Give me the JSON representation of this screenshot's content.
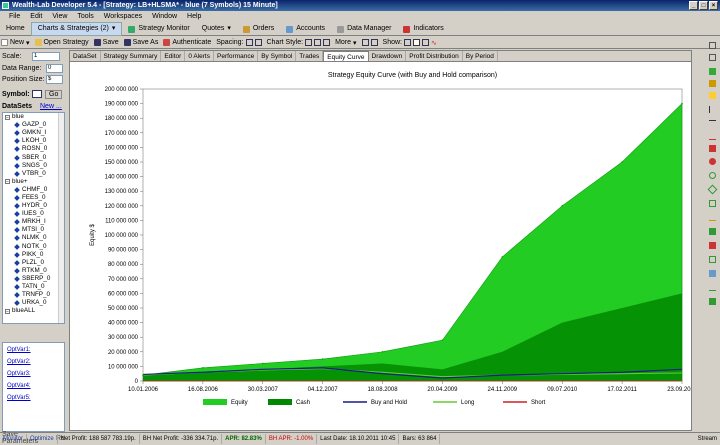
{
  "window": {
    "title": "Wealth-Lab Developer 5.4 - [Strategy: LB+HLSMA* - blue (7 Symbols) 15 Minute]"
  },
  "menu": [
    "File",
    "Edit",
    "View",
    "Tools",
    "Workspaces",
    "Window",
    "Help"
  ],
  "main_tabs": [
    "Home",
    "Charts & Strategies (2)",
    "Strategy Monitor",
    "Quotes",
    "Orders",
    "Accounts",
    "Data Manager",
    "Indicators"
  ],
  "toolbar": {
    "new": "New",
    "open": "Open Strategy",
    "save": "Save",
    "save_as": "Save As",
    "authenticate": "Authenticate",
    "spacing": "Spacing:",
    "chart_style": "Chart Style:",
    "more": "More",
    "show": "Show:"
  },
  "left": {
    "scale_label": "Scale:",
    "scale_value": "1",
    "data_range_label": "Data Range:",
    "data_range_value": "0",
    "position_size_label": "Position Size:",
    "position_size_value": "$",
    "symbol_label": "Symbol:",
    "go": "Go",
    "datasets_label": "DataSets",
    "new_link": "New ..."
  },
  "tree": [
    {
      "type": "group",
      "label": "blue"
    },
    {
      "type": "item",
      "label": "GAZP_0"
    },
    {
      "type": "item",
      "label": "GMKN_I"
    },
    {
      "type": "item",
      "label": "LKOH_0"
    },
    {
      "type": "item",
      "label": "ROSN_0"
    },
    {
      "type": "item",
      "label": "SBER_0"
    },
    {
      "type": "item",
      "label": "SNGS_0"
    },
    {
      "type": "item",
      "label": "VTBR_0"
    },
    {
      "type": "group",
      "label": "blue+"
    },
    {
      "type": "item",
      "label": "CHMF_0"
    },
    {
      "type": "item",
      "label": "FEES_0"
    },
    {
      "type": "item",
      "label": "HYDR_0"
    },
    {
      "type": "item",
      "label": "IUES_0"
    },
    {
      "type": "item",
      "label": "MRKH_I"
    },
    {
      "type": "item",
      "label": "MTSI_0"
    },
    {
      "type": "item",
      "label": "NLMK_0"
    },
    {
      "type": "item",
      "label": "NOTK_0"
    },
    {
      "type": "item",
      "label": "PIKK_0"
    },
    {
      "type": "item",
      "label": "PLZL_0"
    },
    {
      "type": "item",
      "label": "RTKM_0"
    },
    {
      "type": "item",
      "label": "SBERP_0"
    },
    {
      "type": "item",
      "label": "TATN_0"
    },
    {
      "type": "item",
      "label": "TRNFP_0"
    },
    {
      "type": "item",
      "label": "URKA_0"
    },
    {
      "type": "group",
      "label": "blueALL"
    }
  ],
  "opt_vars": [
    "OptVar1:",
    "OptVar2:",
    "OptVar3:",
    "OptVar4:",
    "OptVar5:"
  ],
  "save_parameters": "Save Parameters",
  "save_parameters_short": "Re",
  "sub_tabs": [
    "DataSet",
    "Strategy Summary",
    "Editor",
    "0 Alerts",
    "Performance",
    "By Symbol",
    "Trades",
    "Equity Curve",
    "Drawdown",
    "Profit Distribution",
    "By Period"
  ],
  "active_sub_tab": "Equity Curve",
  "chart_data": {
    "type": "area",
    "title": "Strategy Equity Curve (with Buy and Hold comparison)",
    "ylabel": "Equity $",
    "xlabel": "",
    "ylim": [
      0,
      200000000
    ],
    "yticks": [
      "0",
      "10 000 000",
      "20 000 000",
      "30 000 000",
      "40 000 000",
      "50 000 000",
      "60 000 000",
      "70 000 000",
      "80 000 000",
      "90 000 000",
      "100 000 000",
      "110 000 000",
      "120 000 000",
      "130 000 000",
      "140 000 000",
      "150 000 000",
      "160 000 000",
      "170 000 000",
      "180 000 000",
      "190 000 000",
      "200 000 000"
    ],
    "xticks": [
      "10.01.2006",
      "16.08.2006",
      "30.03.2007",
      "04.12.2007",
      "18.08.2008",
      "20.04.2009",
      "24.11.2009",
      "09.07.2010",
      "17.02.2011",
      "23.09.2011"
    ],
    "x": [
      "10.01.2006",
      "16.08.2006",
      "30.03.2007",
      "04.12.2007",
      "18.08.2008",
      "20.04.2009",
      "24.11.2009",
      "09.07.2010",
      "17.02.2011",
      "23.09.2011"
    ],
    "series": [
      {
        "name": "Equity",
        "color": "#22cc22",
        "values": [
          4000000,
          9000000,
          12000000,
          15000000,
          20000000,
          28000000,
          85000000,
          120000000,
          150000000,
          190000000
        ]
      },
      {
        "name": "Cash",
        "color": "#008800",
        "values": [
          4000000,
          6000000,
          8000000,
          10000000,
          12000000,
          8000000,
          20000000,
          40000000,
          50000000,
          60000000
        ]
      },
      {
        "name": "Buy and Hold",
        "color": "#1a1a8a",
        "values": [
          4500000,
          6000000,
          8000000,
          9000000,
          5000000,
          2000000,
          4000000,
          5000000,
          6000000,
          8000000
        ]
      },
      {
        "name": "Long",
        "color": "#66cc33",
        "values": [
          4000000,
          6000000,
          7500000,
          8500000,
          6000000,
          3000000,
          4000000,
          4500000,
          5000000,
          5500000
        ]
      },
      {
        "name": "Short",
        "color": "#cc2222",
        "values": [
          0,
          0,
          0,
          0,
          0,
          0,
          0,
          0,
          0,
          0
        ]
      }
    ],
    "legend": [
      "Equity",
      "Cash",
      "Buy and Hold",
      "Long",
      "Short"
    ],
    "legend_position": "bottom",
    "grid": false
  },
  "status": {
    "monitor": "Monitor",
    "optimize": "Optimize",
    "net_profit": "Net Profit: 188 587 783.19p.",
    "bh_net_profit": "BH Net Profit: -336 334.71p.",
    "apr": "APR: 82.83%",
    "bh_apr": "BH APR: -1.00%",
    "last_date": "Last Date: 18.10.2011 10:45",
    "bars": "Bars: 63 864",
    "stream": "Stream"
  },
  "colors": {
    "accent": "#0a246a",
    "equity": "#22cc22",
    "cash": "#008800",
    "bh": "#1a1a8a"
  }
}
